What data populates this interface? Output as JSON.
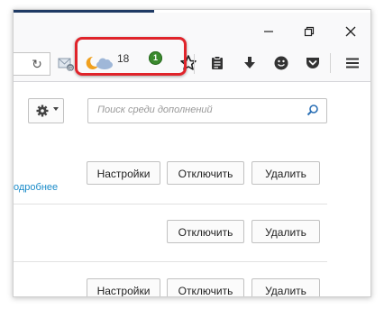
{
  "toolbar": {
    "weather_temp": "18",
    "badge_count": "1"
  },
  "search": {
    "placeholder": "Поиск среди дополнений"
  },
  "addons": [
    {
      "settings": "Настройки",
      "disable": "Отключить",
      "remove": "Удалить",
      "more_link": "одробнее"
    },
    {
      "disable": "Отключить",
      "remove": "Удалить"
    },
    {
      "settings": "Настройки",
      "disable": "Отключить",
      "remove": "Удалить"
    }
  ],
  "colors": {
    "highlight": "#e0242b",
    "link": "#1a8bc9",
    "badge": "#3b8a2e"
  }
}
